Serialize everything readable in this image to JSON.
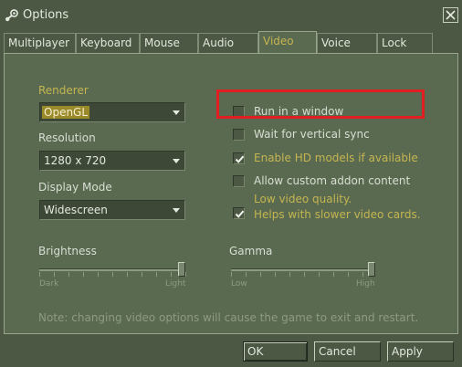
{
  "window": {
    "title": "Options"
  },
  "tabs": [
    {
      "label": "Multiplayer"
    },
    {
      "label": "Keyboard"
    },
    {
      "label": "Mouse"
    },
    {
      "label": "Audio"
    },
    {
      "label": "Video",
      "active": true
    },
    {
      "label": "Voice"
    },
    {
      "label": "Lock"
    }
  ],
  "video": {
    "renderer_label": "Renderer",
    "renderer_value": "OpenGL",
    "resolution_label": "Resolution",
    "resolution_value": "1280 x 720",
    "display_mode_label": "Display Mode",
    "display_mode_value": "Widescreen",
    "options": {
      "run_in_window": {
        "label": "Run in a window",
        "checked": false
      },
      "vsync": {
        "label": "Wait for vertical sync",
        "checked": false
      },
      "hd_models": {
        "label": "Enable HD models if available",
        "checked": true
      },
      "custom_addon": {
        "label": "Allow custom addon content",
        "checked": false
      },
      "low_quality": {
        "label_line1": "Low video quality.",
        "label_line2": "Helps with slower video cards.",
        "checked": true
      }
    },
    "brightness": {
      "label": "Brightness",
      "min_label": "Dark",
      "max_label": "Light",
      "value": 1.0
    },
    "gamma": {
      "label": "Gamma",
      "min_label": "Low",
      "max_label": "High",
      "value": 1.0
    },
    "note": "Note: changing video options will cause the game to exit and restart."
  },
  "buttons": {
    "ok": "OK",
    "cancel": "Cancel",
    "apply": "Apply"
  },
  "colors": {
    "accent": "#c4b550",
    "highlight": "#e11e22",
    "background": "#4c5844",
    "panel": "#5a6a50"
  }
}
